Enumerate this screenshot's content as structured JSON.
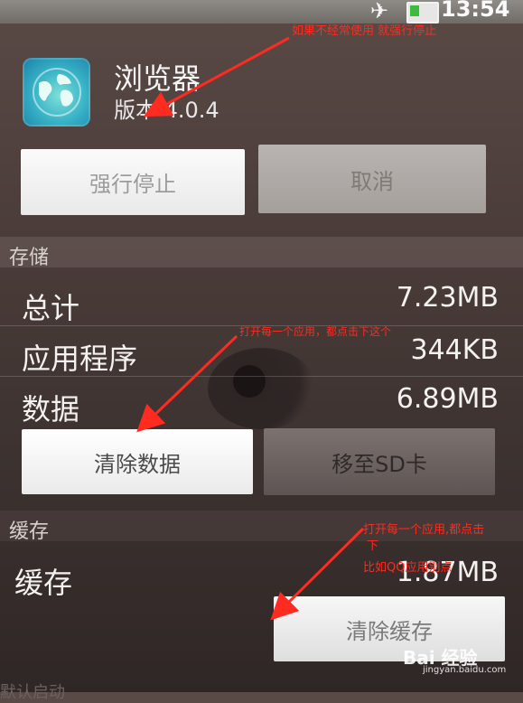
{
  "status_bar": {
    "time": "13:54",
    "airplane_icon": "airplane-icon",
    "battery_icon": "battery-icon"
  },
  "app": {
    "name": "浏览器",
    "version": "版本 4.0.4",
    "icon": "browser-globe-icon"
  },
  "buttons": {
    "force_stop": "强行停止",
    "cancel": "取消",
    "clear_data": "清除数据",
    "move": "移至SD卡",
    "clear_cache": "清除缓存"
  },
  "storage": {
    "header": "存储",
    "rows": [
      {
        "label": "总计",
        "value": "7.23MB"
      },
      {
        "label": "应用程序",
        "value": "344KB"
      },
      {
        "label": "数据",
        "value": "6.89MB"
      }
    ]
  },
  "cache": {
    "header": "缓存",
    "label": "缓存",
    "value": "1.87MB"
  },
  "bottom_partial": "默认启动",
  "annotations": {
    "note1": "如果不经常使用 就强行停止",
    "note2": "打开每一个应用，都点击下这个",
    "note3_line1": "打开每一个应用,都点击",
    "note3_line2": "下",
    "note3_line3": "比如QQ应用别点"
  },
  "watermark": {
    "brand": "Bai 经验",
    "url": "jingyan.baidu.com"
  },
  "colors": {
    "annotation_red": "#ff2a20",
    "icon_teal": "#37b2c6"
  }
}
